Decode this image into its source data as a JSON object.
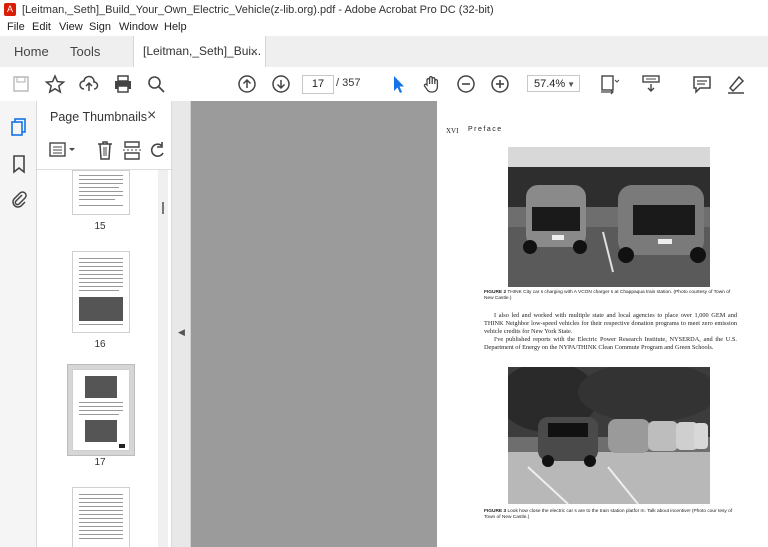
{
  "window": {
    "title": "[Leitman,_Seth]_Build_Your_Own_Electric_Vehicle(z-lib.org).pdf - Adobe Acrobat Pro DC (32-bit)"
  },
  "menu": [
    "File",
    "Edit",
    "View",
    "Sign",
    "Window",
    "Help"
  ],
  "tabs": {
    "home": "Home",
    "tools": "Tools",
    "document": "[Leitman,_Seth]_Bui...",
    "close": "×"
  },
  "toolbar": {
    "current_page": "17",
    "total_pages": "/  357",
    "zoom": "57.4%"
  },
  "thumbnails": {
    "header": "Page Thumbnails",
    "close": "×",
    "pages": [
      "15",
      "16",
      "17"
    ]
  },
  "pdf_page": {
    "page_number": "XVI",
    "running_head": "Preface",
    "figure2_caption_bold": "FIGURE 2",
    "figure2_caption": "THINK City car s charging with A VCON charger s at Chappaqua train station. (Photo courtesy of Town of New Castle.)",
    "paragraph1": "I also led and worked with multiple state and local agencies to place over 1,000 GEM and THINK Neighbor low-speed vehicles for their respective donation programs to meet zero emission vehicle credits for New York State.",
    "paragraph2": "I've published reports with the Electric Power Research Institute, NYSERDA, and the U.S. Department of Energy on the NYPA/THINK Clean Commute Program and Green Schools.",
    "figure3_caption_bold": "FIGURE 3",
    "figure3_caption": "Look how close the electric car s are to the train station platfor m. Talk about incentive! (Photo cour tesy of Town of New Castle.)"
  },
  "colors": {
    "accent": "#1473e6",
    "acrobat_red": "#d81e05"
  }
}
